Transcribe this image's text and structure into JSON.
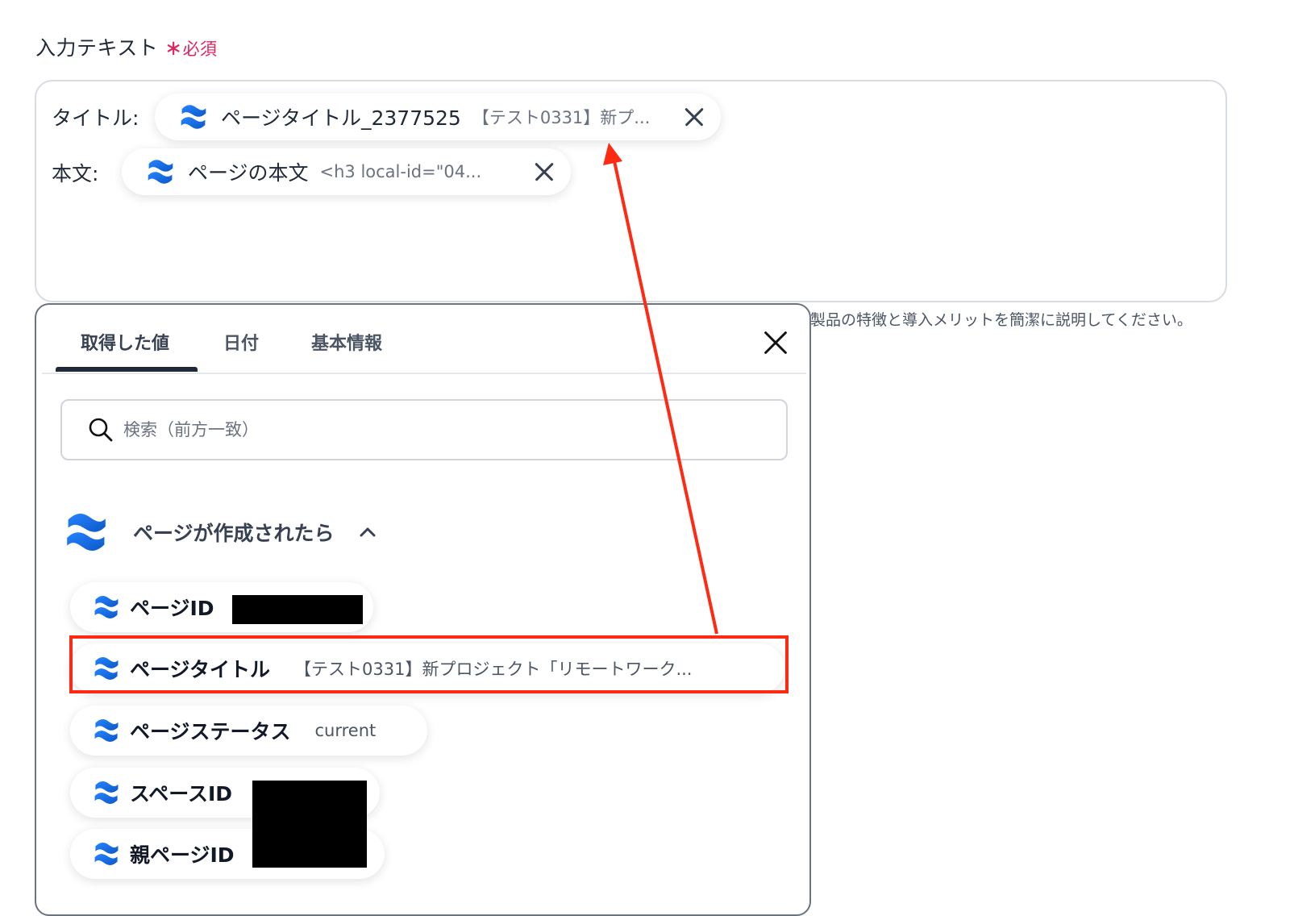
{
  "field": {
    "label": "入力テキスト",
    "required_mark": "∗",
    "required_text": "必須"
  },
  "input_rows": [
    {
      "label": "タイトル:",
      "chip_label": "ページタイトル_2377525",
      "chip_value": "【テスト0331】新プ..."
    },
    {
      "label": "本文:",
      "chip_label": "ページの本文",
      "chip_value": "<h3 local-id=\"04..."
    }
  ],
  "hint_text": "製品の特徴と導入メリットを簡潔に説明してください。",
  "panel": {
    "tabs": [
      {
        "label": "取得した値",
        "active": true
      },
      {
        "label": "日付",
        "active": false
      },
      {
        "label": "基本情報",
        "active": false
      }
    ],
    "search_placeholder": "検索（前方一致）",
    "group_title": "ページが作成されたら",
    "items": [
      {
        "name": "ページID",
        "value": ""
      },
      {
        "name": "ページタイトル",
        "value": "【テスト0331】新プロジェクト「リモートワーク..."
      },
      {
        "name": "ページステータス",
        "value": "current"
      },
      {
        "name": "スペースID",
        "value": ""
      },
      {
        "name": "親ページID",
        "value": ""
      }
    ]
  },
  "colors": {
    "required": "#e0245e",
    "annotation": "#ff2a13",
    "logo_blue": "#1868db"
  },
  "icons": [
    "confluence-logo-icon",
    "close-icon",
    "search-icon",
    "chevron-up-icon"
  ]
}
